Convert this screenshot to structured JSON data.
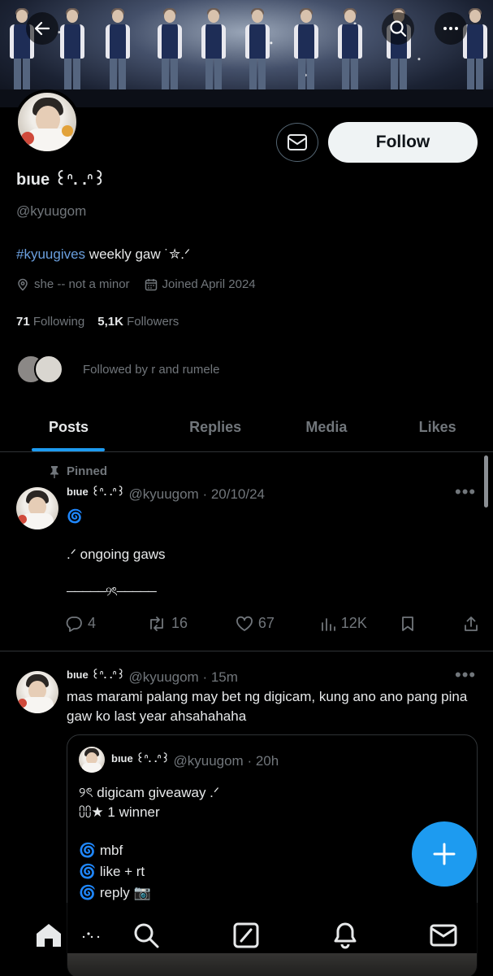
{
  "profile": {
    "display_name": "bıue ꒰ᐢ. .ᐢ꒱",
    "handle": "@kyuugom",
    "bio_tag": "#kyuugives",
    "bio_rest": " weekly gaw ˙✮.ᐟ",
    "location": "she -- not a minor",
    "joined": "Joined April 2024",
    "following_count": "71",
    "following_label": "Following",
    "followers_count": "5,1K",
    "followers_label": "Followers",
    "followed_by": "Followed by r and rumele",
    "follow_label": "Follow"
  },
  "tabs": [
    {
      "label": "Posts",
      "active": true
    },
    {
      "label": "Replies",
      "active": false
    },
    {
      "label": "Media",
      "active": false
    },
    {
      "label": "Likes",
      "active": false
    }
  ],
  "posts": [
    {
      "pinned_label": "Pinned",
      "name": "bıue ꒰ᐢ. .ᐢ꒱",
      "meta": "@kyuugom · 20/10/24",
      "line1": "🌀",
      "line2": ".ᐟ ongoing gaws",
      "line3": "─────୨ৎ─────",
      "replies": "4",
      "reposts": "16",
      "likes": "67",
      "views": "12K"
    },
    {
      "name": "bıue ꒰ᐢ. .ᐢ꒱",
      "meta": "@kyuugom · 15m",
      "text": "mas marami palang may bet ng digicam, kung ano ano pang pina gaw ko last year ahsahahaha",
      "quote": {
        "name": "bıue ꒰ᐢ. .ᐢ꒱",
        "meta": "@kyuugom · 20h",
        "lines": [
          "୨ৎ digicam giveaway .ᐟ",
          "⩇⩇★ 1 winner",
          "🌀 mbf",
          "🌀 like + rt",
          "🌀 reply 📷"
        ]
      }
    }
  ],
  "icons": {
    "back": "back-arrow-icon",
    "search": "search-icon",
    "more": "more-icon",
    "compose": "plus-icon"
  },
  "colors": {
    "accent": "#1d9bf0",
    "hashtag": "#6a9fde",
    "muted": "#71767b"
  }
}
